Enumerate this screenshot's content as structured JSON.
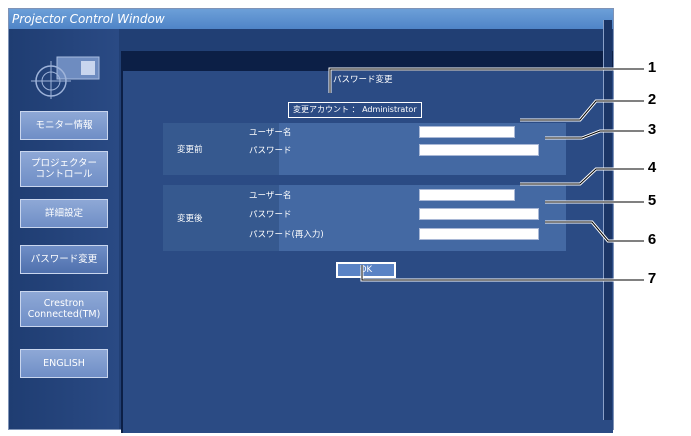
{
  "window": {
    "title": "Projector Control Window"
  },
  "sidebar": {
    "items": [
      {
        "label": "モニター情報"
      },
      {
        "label": "プロジェクター\nコントロール"
      },
      {
        "label": "詳細設定"
      },
      {
        "label": "パスワード変更",
        "active": true
      },
      {
        "label": "Crestron\nConnected(TM)"
      },
      {
        "label": "ENGLISH"
      }
    ]
  },
  "main": {
    "page_title": "パスワード変更",
    "account_text": "変更アカウント ： Administrator",
    "before": {
      "label": "変更前",
      "username_label": "ユーザー名",
      "password_label": "パスワード",
      "username_value": "",
      "password_value": ""
    },
    "after": {
      "label": "変更後",
      "username_label": "ユーザー名",
      "password_label": "パスワード",
      "password_confirm_label": "パスワード(再入力)",
      "username_value": "",
      "password_value": "",
      "password_confirm_value": ""
    },
    "ok_label": "OK"
  },
  "callouts": [
    "1",
    "2",
    "3",
    "4",
    "5",
    "6",
    "7"
  ],
  "colors": {
    "window_bg": "#213f74",
    "titlebar": "#5a8fd0",
    "button": "#7d9bcf",
    "content_bg": "#2b4b84"
  }
}
